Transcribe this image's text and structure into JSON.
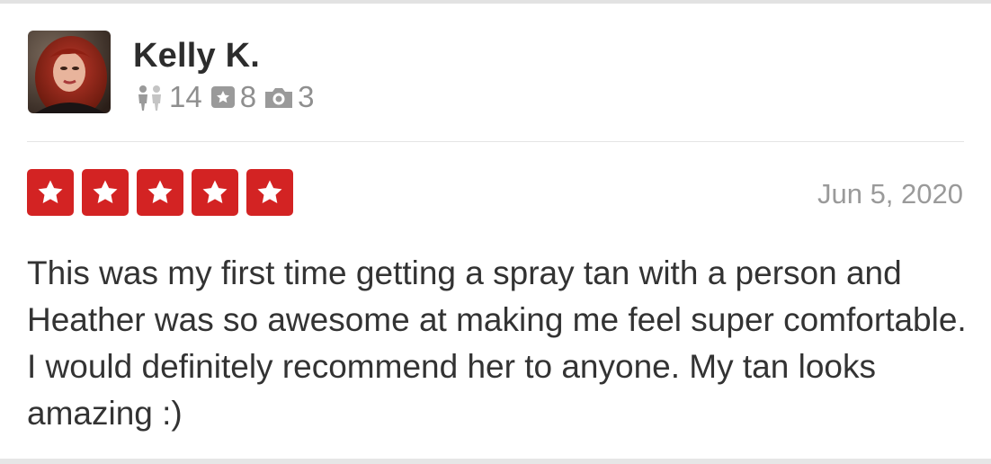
{
  "review": {
    "user": {
      "name": "Kelly K.",
      "avatar_icon": "user-avatar-photo",
      "stats": {
        "friends": "14",
        "reviews": "8",
        "photos": "3"
      }
    },
    "rating": 5,
    "rating_max": 5,
    "date": "Jun 5, 2020",
    "text": "This was my first time getting a spray tan with a person and Heather was so awesome at making me feel super comfortable. I would definitely recommend her to anyone. My tan looks amazing :)"
  },
  "colors": {
    "star_red": "#d32323",
    "muted_text": "#8f8f8f",
    "body_text": "#333333"
  },
  "icons": [
    "friends-icon",
    "review-star-icon",
    "camera-icon",
    "star-icon"
  ]
}
